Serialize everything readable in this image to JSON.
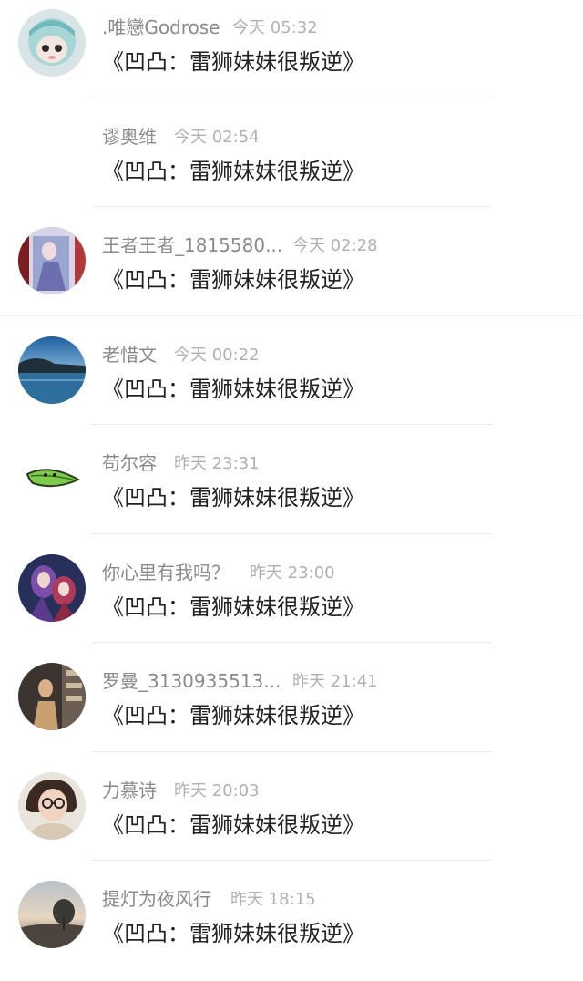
{
  "comments": [
    {
      "user": ".唯戀Godrose",
      "time": "今天 05:32",
      "text": "《凹凸：雷狮妹妹很叛逆》",
      "avatar": "figure-doll-avatar"
    },
    {
      "user": "谬奥维",
      "time": "今天 02:54",
      "text": "《凹凸：雷狮妹妹很叛逆》",
      "avatar": ""
    },
    {
      "user": "王者王者_1815580...",
      "time": "今天 02:28",
      "text": "《凹凸：雷狮妹妹很叛逆》",
      "avatar": "game-character-avatar"
    },
    {
      "user": "老惜文",
      "time": "今天 00:22",
      "text": "《凹凸：雷狮妹妹很叛逆》",
      "avatar": "lake-landscape-avatar"
    },
    {
      "user": "苟尔容",
      "time": "昨天 23:31",
      "text": "《凹凸：雷狮妹妹很叛逆》",
      "avatar": "green-leaf-bird-avatar"
    },
    {
      "user": "你心里有我吗？",
      "time": "昨天 23:00",
      "text": "《凹凸：雷狮妹妹很叛逆》",
      "avatar": "anime-girls-avatar"
    },
    {
      "user": "罗曼_3130935513...",
      "time": "昨天 21:41",
      "text": "《凹凸：雷狮妹妹很叛逆》",
      "avatar": "cafe-photo-avatar"
    },
    {
      "user": "力慕诗",
      "time": "昨天 20:03",
      "text": "《凹凸：雷狮妹妹很叛逆》",
      "avatar": "girl-glasses-avatar"
    },
    {
      "user": "提灯为夜风行",
      "time": "昨天 18:15",
      "text": "《凹凸：雷狮妹妹很叛逆》",
      "avatar": "sunset-tree-avatar"
    }
  ],
  "colors": {
    "username": "#8a8a8a",
    "timestamp": "#b0b0b0",
    "comment_text": "#222222",
    "divider": "#ececec"
  }
}
